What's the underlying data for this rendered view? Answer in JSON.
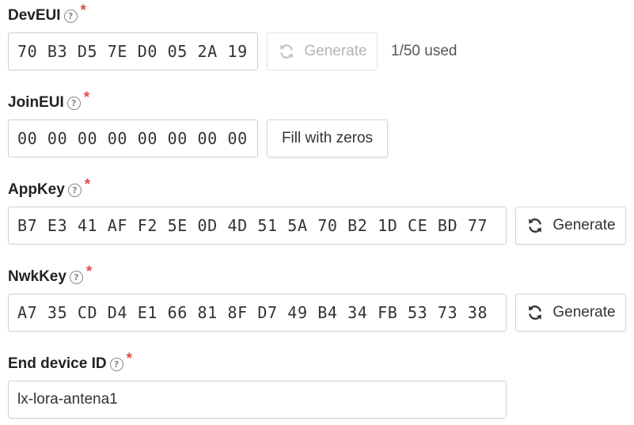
{
  "fields": {
    "deveui": {
      "label": "DevEUI",
      "required_mark": "*",
      "value": "70 B3 D5 7E D0 05 2A 19",
      "generate_label": "Generate",
      "usage": "1/50 used"
    },
    "joineui": {
      "label": "JoinEUI",
      "required_mark": "*",
      "value": "00 00 00 00 00 00 00 00",
      "fill_label": "Fill with zeros"
    },
    "appkey": {
      "label": "AppKey",
      "required_mark": "*",
      "value": "B7 E3 41 AF F2 5E 0D 4D 51 5A 70 B2 1D CE BD 77",
      "generate_label": "Generate"
    },
    "nwkkey": {
      "label": "NwkKey",
      "required_mark": "*",
      "value": "A7 35 CD D4 E1 66 81 8F D7 49 B4 34 FB 53 73 38",
      "generate_label": "Generate"
    },
    "device_id": {
      "label": "End device ID",
      "required_mark": "*",
      "value": "lx-lora-antena1"
    }
  },
  "colors": {
    "required": "#e04b4b",
    "disabled_text": "#b4b4b4",
    "border": "#cfcfcf"
  },
  "icons": {
    "help": "question-circle-icon",
    "generate": "refresh-icon"
  }
}
